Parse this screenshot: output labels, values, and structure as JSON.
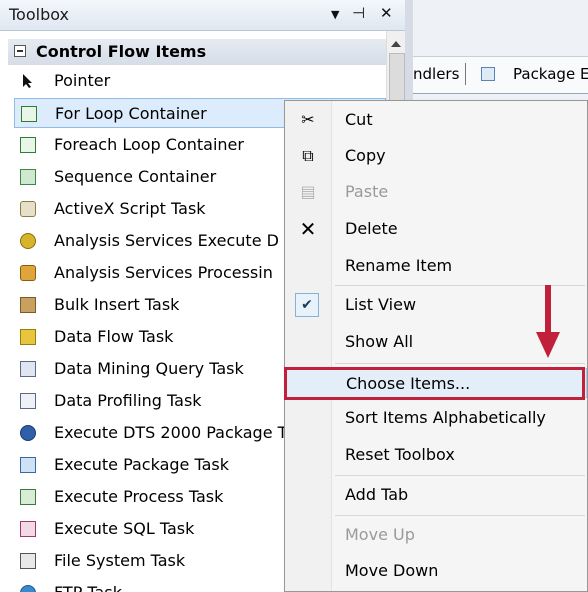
{
  "toolbox": {
    "title": "Toolbox",
    "controls": {
      "dropdown": "▼",
      "pin": "⊣",
      "close": "✕"
    },
    "category": "Control Flow Items",
    "items": [
      {
        "label": "Pointer",
        "icon": "pointer-icon"
      },
      {
        "label": "For Loop Container",
        "icon": "for-loop-icon"
      },
      {
        "label": "Foreach Loop Container",
        "icon": "foreach-loop-icon"
      },
      {
        "label": "Sequence Container",
        "icon": "sequence-container-icon"
      },
      {
        "label": "ActiveX Script Task",
        "icon": "activex-script-icon"
      },
      {
        "label": "Analysis Services Execute D",
        "icon": "analysis-execute-icon"
      },
      {
        "label": "Analysis Services Processin",
        "icon": "analysis-processing-icon"
      },
      {
        "label": "Bulk Insert Task",
        "icon": "bulk-insert-icon"
      },
      {
        "label": "Data Flow Task",
        "icon": "data-flow-icon"
      },
      {
        "label": "Data Mining Query Task",
        "icon": "data-mining-icon"
      },
      {
        "label": "Data Profiling Task",
        "icon": "data-profiling-icon"
      },
      {
        "label": "Execute DTS 2000 Package T",
        "icon": "execute-dts-icon"
      },
      {
        "label": "Execute Package Task",
        "icon": "execute-package-icon"
      },
      {
        "label": "Execute Process Task",
        "icon": "execute-process-icon"
      },
      {
        "label": "Execute SQL Task",
        "icon": "execute-sql-icon"
      },
      {
        "label": "File System Task",
        "icon": "file-system-icon"
      },
      {
        "label": "FTP Task",
        "icon": "ftp-icon"
      }
    ],
    "selected_index": 1
  },
  "designer_tabs": {
    "tab1": "ndlers",
    "tab2": "Package E"
  },
  "context_menu": {
    "items": {
      "cut": "Cut",
      "copy": "Copy",
      "paste": "Paste",
      "delete": "Delete",
      "rename": "Rename Item",
      "list_view": "List View",
      "show_all": "Show All",
      "choose_items": "Choose Items...",
      "sort": "Sort Items Alphabetically",
      "reset": "Reset Toolbox",
      "add_tab": "Add Tab",
      "move_up": "Move Up",
      "move_down": "Move Down"
    },
    "checkmark": "✔"
  },
  "colors": {
    "highlight": "#c0203a",
    "selection": "#dcecfc"
  }
}
